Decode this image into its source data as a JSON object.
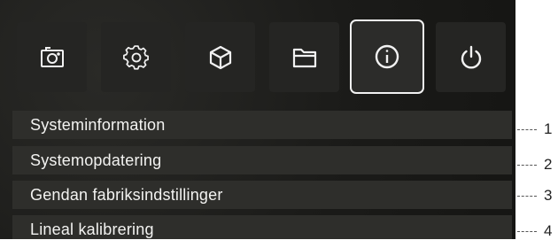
{
  "toolbar": {
    "buttons": [
      {
        "icon": "camera-icon"
      },
      {
        "icon": "gear-icon"
      },
      {
        "icon": "cube-icon"
      },
      {
        "icon": "folder-icon"
      },
      {
        "icon": "info-icon",
        "active": true
      },
      {
        "icon": "power-icon"
      }
    ]
  },
  "menu": {
    "items": [
      {
        "label": "Systeminformation"
      },
      {
        "label": "Systemopdatering"
      },
      {
        "label": "Gendan fabriksindstillinger"
      },
      {
        "label": "Lineal kalibrering"
      }
    ]
  },
  "callouts": [
    "1",
    "2",
    "3",
    "4"
  ],
  "colors": {
    "background": "#1b1b19",
    "button": "#252523",
    "row": "#2e2e2b",
    "text": "#f3f3f1",
    "active_border": "#f2f2f2"
  }
}
